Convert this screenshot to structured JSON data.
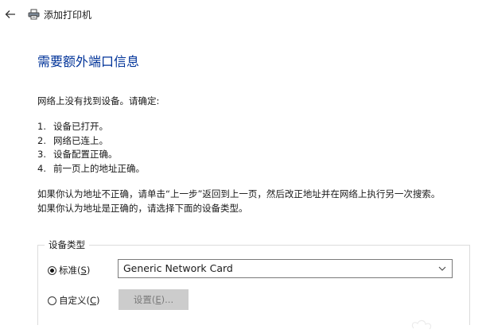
{
  "window": {
    "title": "添加打印机"
  },
  "icons": {
    "back": "back-arrow-icon",
    "printer": "printer-icon",
    "dropdown": "chevron-down-icon"
  },
  "colors": {
    "heading": "#003399",
    "disabled_button_bg": "#cccccc",
    "disabled_text": "#7a7a7a"
  },
  "main": {
    "heading": "需要额外端口信息",
    "intro": "网络上没有找到设备。请确定:",
    "checklist": [
      {
        "num": "1.",
        "text": "设备已打开。"
      },
      {
        "num": "2.",
        "text": "网络已连上。"
      },
      {
        "num": "3.",
        "text": "设备配置正确。"
      },
      {
        "num": "4.",
        "text": "前一页上的地址正确。"
      }
    ],
    "instruction_line1": "如果你认为地址不正确，请单击“上一步”返回到上一页，然后改正地址并在网络上执行另一次搜索。",
    "instruction_line2": "如果你认为地址是正确的，请选择下面的设备类型。"
  },
  "device_type": {
    "group_label": "设备类型",
    "standard": {
      "label_prefix": "标准(",
      "mnemonic": "S",
      "label_suffix": ")",
      "checked": true
    },
    "custom": {
      "label_prefix": "自定义(",
      "mnemonic": "C",
      "label_suffix": ")",
      "checked": false
    },
    "selected_value": "Generic Network Card",
    "settings_button": {
      "label_prefix": "设置(",
      "mnemonic": "E",
      "label_suffix": ")...",
      "enabled": false
    }
  }
}
